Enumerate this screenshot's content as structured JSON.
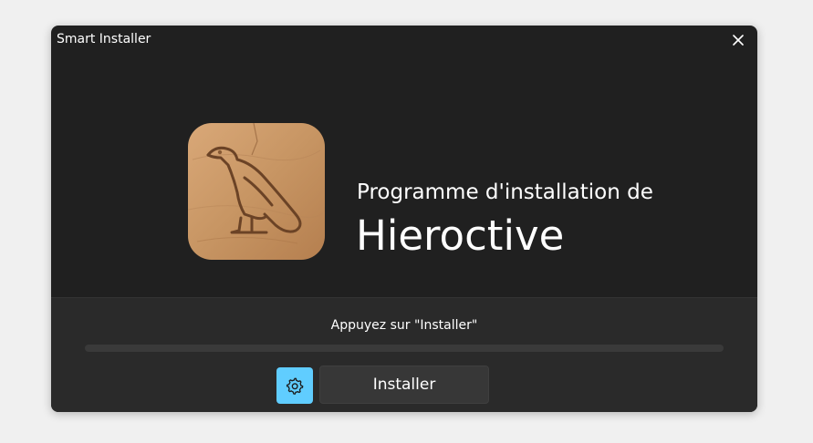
{
  "window": {
    "title": "Smart Installer"
  },
  "hero": {
    "subtitle": "Programme d'installation de",
    "app_name": "Hieroctive"
  },
  "footer": {
    "status": "Appuyez sur \"Installer\"",
    "progress_fraction": 0.0,
    "install_label": "Installer"
  },
  "icons": {
    "close": "close-icon",
    "settings": "gear-icon",
    "app": "falcon-hieroglyph-icon"
  },
  "colors": {
    "accent": "#60cdff",
    "window_bg": "#202020",
    "footer_bg": "#2a2a2a"
  }
}
